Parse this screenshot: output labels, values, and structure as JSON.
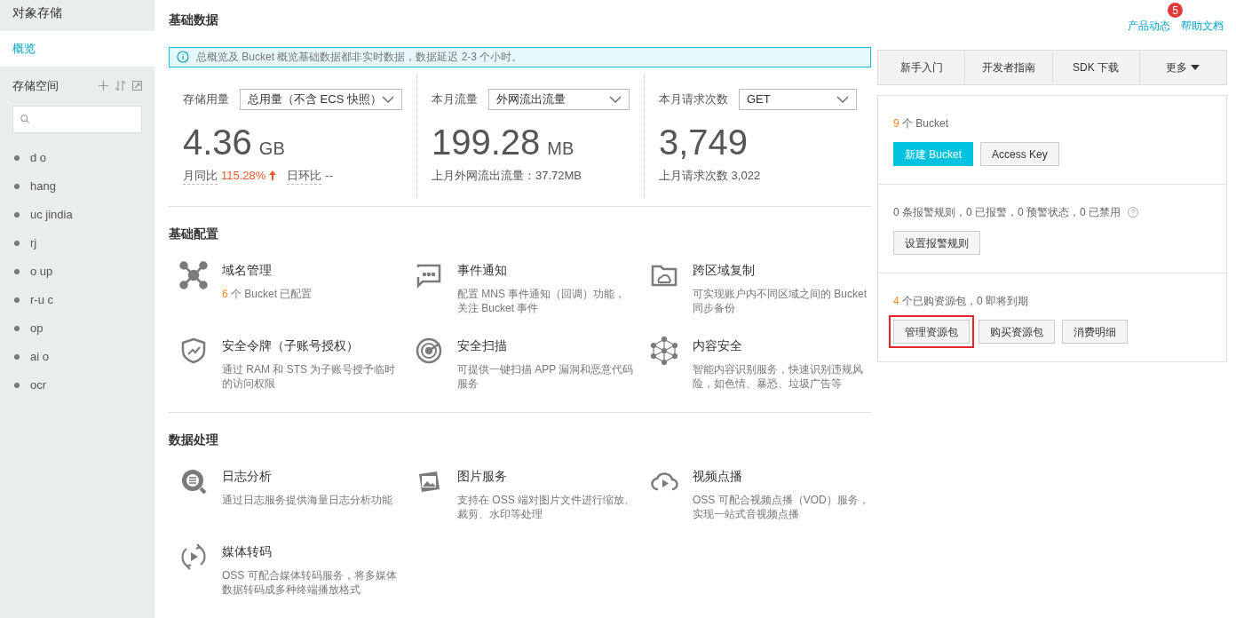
{
  "sidebar": {
    "title": "对象存储",
    "nav": [
      {
        "label": "概览",
        "selected": true
      }
    ],
    "buckets_title": "存储空间",
    "buckets": [
      {
        "name": "d o"
      },
      {
        "name": "hang"
      },
      {
        "name": "uc jindia"
      },
      {
        "name": "rj"
      },
      {
        "name": "o up"
      },
      {
        "name": "r-u c"
      },
      {
        "name": "op"
      },
      {
        "name": "ai o"
      },
      {
        "name": "ocr"
      }
    ]
  },
  "header": {
    "title": "基础数据",
    "links": [
      {
        "label": "产品动态",
        "badge": "5"
      },
      {
        "label": "帮助文档"
      }
    ]
  },
  "notice": "总概览及 Bucket 概览基础数据都非实时数据，数据延迟 2-3 个小时。",
  "metrics": [
    {
      "label": "存储用量",
      "select": "总用量（不含 ECS 快照）",
      "value": "4.36",
      "unit": "GB",
      "kind": "compare",
      "compare": [
        {
          "label": "月同比",
          "value": "115.28%",
          "rising": true
        },
        {
          "label": "日环比",
          "value": "--",
          "rising": false
        }
      ]
    },
    {
      "label": "本月流量",
      "select": "外网流出流量",
      "value": "199.28",
      "unit": "MB",
      "kind": "note",
      "note": "上月外网流出流量：37.72MB"
    },
    {
      "label": "本月请求次数",
      "select": "GET",
      "value": "3,749",
      "kind": "note",
      "note": "上月请求次数 3,022"
    }
  ],
  "sections": [
    {
      "title": "基础配置",
      "items": [
        {
          "kind": "nodes",
          "title": "域名管理",
          "count": "6",
          "desc": "个 Bucket 已配置"
        },
        {
          "kind": "message",
          "title": "事件通知",
          "desc": "配置 MNS 事件通知（回调）功能，关注 Bucket 事件"
        },
        {
          "kind": "folder",
          "title": "跨区域复制",
          "desc": "可实现账户内不同区域之间的 Bucket 同步备份"
        },
        {
          "kind": "shield",
          "title": "安全令牌（子账号授权）",
          "desc": "通过 RAM 和 STS 为子账号授予临时的访问权限"
        },
        {
          "kind": "radar",
          "title": "安全扫描",
          "desc": "可提供一键扫描 APP 漏洞和恶意代码服务"
        },
        {
          "kind": "network",
          "title": "内容安全",
          "desc": "智能内容识别服务，快速识别违规风险，如色情、暴恐、垃圾广告等"
        }
      ]
    },
    {
      "title": "数据处理",
      "items": [
        {
          "kind": "log",
          "title": "日志分析",
          "desc": "通过日志服务提供海量日志分析功能"
        },
        {
          "kind": "image",
          "title": "图片服务",
          "desc": "支持在 OSS 端对图片文件进行缩放、裁剪、水印等处理"
        },
        {
          "kind": "cloudplay",
          "title": "视频点播",
          "desc": "OSS 可配合视频点播（VOD）服务，实现一站式音视频点播"
        },
        {
          "kind": "convert",
          "title": "媒体转码",
          "desc": "OSS 可配合媒体转码服务，将多媒体数据转码成多种终端播放格式"
        }
      ]
    }
  ],
  "quick_links": [
    {
      "label": "新手入门",
      "dropdown": false
    },
    {
      "label": "开发者指南",
      "dropdown": false
    },
    {
      "label": "SDK 下载",
      "dropdown": false
    },
    {
      "label": "更多",
      "dropdown": true
    }
  ],
  "panels": [
    {
      "count": "9",
      "text": "个 Bucket",
      "help": false,
      "buttons": [
        {
          "label": "新建 Bucket",
          "primary": true,
          "highlighted": false
        },
        {
          "label": "Access Key",
          "primary": false,
          "highlighted": false
        }
      ]
    },
    {
      "text": "0 条报警规则，0 已报警，0 预警状态，0 已禁用",
      "help": true,
      "buttons": [
        {
          "label": "设置报警规则",
          "primary": false,
          "highlighted": false
        }
      ]
    },
    {
      "count": "4",
      "text": "个已购资源包，0 即将到期",
      "help": false,
      "buttons": [
        {
          "label": "管理资源包",
          "primary": false,
          "highlighted": true
        },
        {
          "label": "购买资源包",
          "primary": false,
          "highlighted": false
        },
        {
          "label": "消费明细",
          "primary": false,
          "highlighted": false
        }
      ]
    }
  ]
}
